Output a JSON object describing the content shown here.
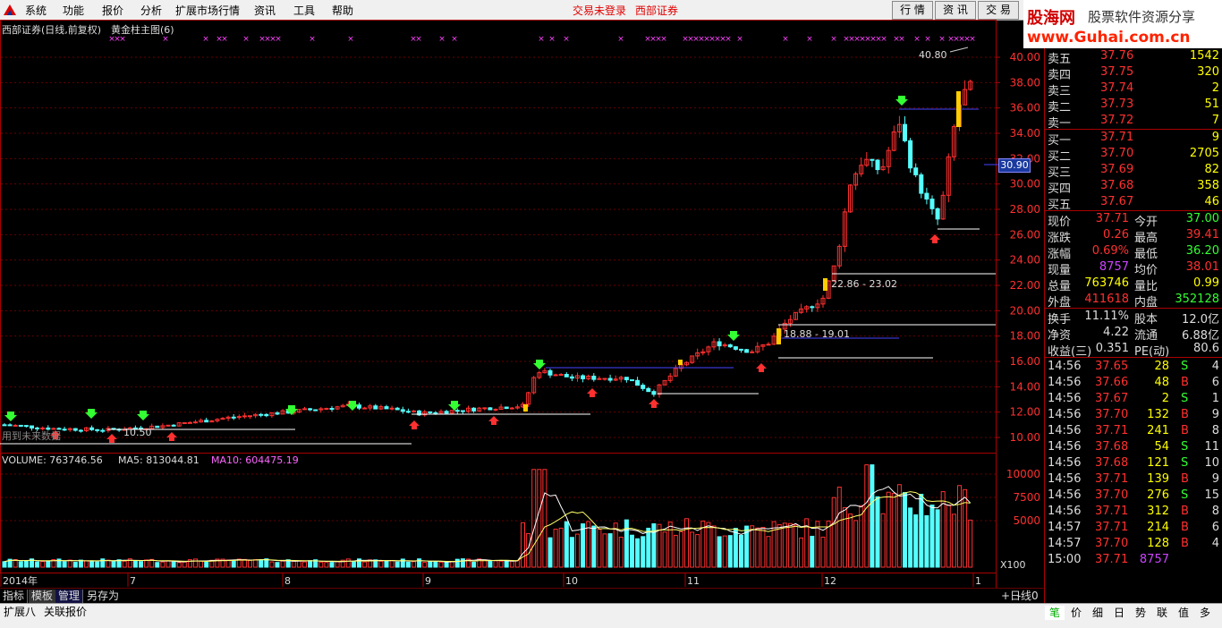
{
  "menu": {
    "items": [
      "系统",
      "功能",
      "报价",
      "分析",
      "扩展市场行情",
      "资讯",
      "工具",
      "帮助"
    ],
    "status_login": "交易未登录",
    "status_broker": "西部证券",
    "top_buttons": [
      "行 情",
      "资 讯",
      "交 易"
    ]
  },
  "banner": {
    "site": "股海网",
    "slogan": "股票软件资源分享",
    "url": "www.Guhai.com.cn"
  },
  "chart": {
    "header": "西部证券(日线,前复权)",
    "indicator": "黄金柱主图(6)",
    "price_ticks": [
      "40.00",
      "38.00",
      "36.00",
      "34.00",
      "32.00",
      "30.00",
      "28.00",
      "26.00",
      "24.00",
      "22.00",
      "20.00",
      "18.00",
      "16.00",
      "14.00",
      "12.00",
      "10.00"
    ],
    "current_price_tag": "30.90",
    "annotations": {
      "high": "40.80",
      "band1": "22.86 - 23.02",
      "band2": "18.88 - 19.01",
      "low": "10.50",
      "future_note": "用到未来数据"
    },
    "volume_label": "VOLUME: 763746.56",
    "ma5_label": "MA5: 813044.81",
    "ma10_label": "MA10: 604475.19",
    "volume_ticks": [
      "10000",
      "7500",
      "5000"
    ],
    "volume_unit": "X100",
    "x_labels": [
      "2014年",
      "7",
      "8",
      "9",
      "10",
      "11",
      "12",
      "1"
    ],
    "period": "日线"
  },
  "bottom_tabs": [
    "指标",
    "模板",
    "管理",
    "另存为"
  ],
  "bottom_tabs2": [
    "扩展八",
    "关联报价"
  ],
  "zoom_buttons": [
    "+",
    "-",
    "0"
  ],
  "right_tabs": [
    "笔",
    "价",
    "细",
    "日",
    "势",
    "联",
    "值",
    "多"
  ],
  "quote": {
    "asks": [
      {
        "label": "卖五",
        "price": "37.76",
        "vol": "1542"
      },
      {
        "label": "卖四",
        "price": "37.75",
        "vol": "320"
      },
      {
        "label": "卖三",
        "price": "37.74",
        "vol": "2"
      },
      {
        "label": "卖二",
        "price": "37.73",
        "vol": "51"
      },
      {
        "label": "卖一",
        "price": "37.72",
        "vol": "7"
      }
    ],
    "bids": [
      {
        "label": "买一",
        "price": "37.71",
        "vol": "9"
      },
      {
        "label": "买二",
        "price": "37.70",
        "vol": "2705"
      },
      {
        "label": "买三",
        "price": "37.69",
        "vol": "82"
      },
      {
        "label": "买四",
        "price": "37.68",
        "vol": "358"
      },
      {
        "label": "买五",
        "price": "37.67",
        "vol": "46"
      }
    ],
    "stats": [
      {
        "l1": "现价",
        "v1": "37.71",
        "l2": "今开",
        "v2": "37.00",
        "c1": "#ff3030",
        "c2": "#33ff33"
      },
      {
        "l1": "涨跌",
        "v1": "0.26",
        "l2": "最高",
        "v2": "39.41",
        "c1": "#ff3030",
        "c2": "#ff3030"
      },
      {
        "l1": "涨幅",
        "v1": "0.69%",
        "l2": "最低",
        "v2": "36.20",
        "c1": "#ff3030",
        "c2": "#33ff33"
      },
      {
        "l1": "现量",
        "v1": "8757",
        "l2": "均价",
        "v2": "38.01",
        "c1": "#cc44ff",
        "c2": "#ff3030"
      },
      {
        "l1": "总量",
        "v1": "763746",
        "l2": "量比",
        "v2": "0.99",
        "c1": "#ffff00",
        "c2": "#ffff00"
      },
      {
        "l1": "外盘",
        "v1": "411618",
        "l2": "内盘",
        "v2": "352128",
        "c1": "#ff3030",
        "c2": "#33ff33"
      }
    ],
    "fund": [
      {
        "l1": "换手",
        "v1": "11.11%",
        "l2": "股本",
        "v2": "12.0亿"
      },
      {
        "l1": "净资",
        "v1": "4.22",
        "l2": "流通",
        "v2": "6.88亿"
      },
      {
        "l1": "收益(三)",
        "v1": "0.351",
        "l2": "PE(动)",
        "v2": "80.6"
      }
    ],
    "ticks": [
      {
        "t": "14:56",
        "p": "37.65",
        "v": "28",
        "s": "S",
        "n": "4"
      },
      {
        "t": "14:56",
        "p": "37.66",
        "v": "48",
        "s": "B",
        "n": "6"
      },
      {
        "t": "14:56",
        "p": "37.67",
        "v": "2",
        "s": "S",
        "n": "1"
      },
      {
        "t": "14:56",
        "p": "37.70",
        "v": "132",
        "s": "B",
        "n": "9"
      },
      {
        "t": "14:56",
        "p": "37.71",
        "v": "241",
        "s": "B",
        "n": "8"
      },
      {
        "t": "14:56",
        "p": "37.68",
        "v": "54",
        "s": "S",
        "n": "11"
      },
      {
        "t": "14:56",
        "p": "37.68",
        "v": "121",
        "s": "S",
        "n": "10"
      },
      {
        "t": "14:56",
        "p": "37.71",
        "v": "139",
        "s": "B",
        "n": "9"
      },
      {
        "t": "14:56",
        "p": "37.70",
        "v": "276",
        "s": "S",
        "n": "15"
      },
      {
        "t": "14:56",
        "p": "37.71",
        "v": "312",
        "s": "B",
        "n": "8"
      },
      {
        "t": "14:57",
        "p": "37.71",
        "v": "214",
        "s": "B",
        "n": "6"
      },
      {
        "t": "14:57",
        "p": "37.70",
        "v": "128",
        "s": "B",
        "n": "4"
      },
      {
        "t": "15:00",
        "p": "37.71",
        "v": "8757",
        "s": "",
        "n": ""
      }
    ]
  }
}
